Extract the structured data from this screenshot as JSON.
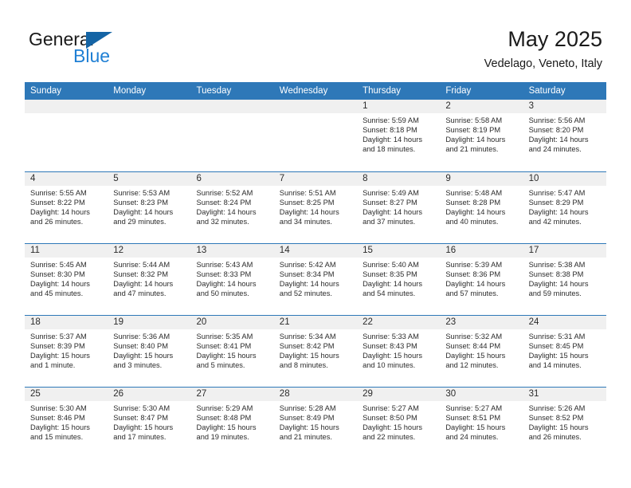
{
  "brand": {
    "name_part1": "General",
    "name_part2": "Blue",
    "flag_icon": "triangle-flag-icon",
    "accent_dark": "#1464a5",
    "accent_blue": "#1f7fd4"
  },
  "header": {
    "title": "May 2025",
    "subtitle": "Vedelago, Veneto, Italy"
  },
  "calendar": {
    "header_bg": "#2e78b8",
    "daynumber_bg": "#f0f0f0",
    "weekdays": [
      "Sunday",
      "Monday",
      "Tuesday",
      "Wednesday",
      "Thursday",
      "Friday",
      "Saturday"
    ],
    "weeks": [
      [
        {
          "day": "",
          "empty": true
        },
        {
          "day": "",
          "empty": true
        },
        {
          "day": "",
          "empty": true
        },
        {
          "day": "",
          "empty": true
        },
        {
          "day": "1",
          "sunrise": "Sunrise: 5:59 AM",
          "sunset": "Sunset: 8:18 PM",
          "daylight": "Daylight: 14 hours and 18 minutes."
        },
        {
          "day": "2",
          "sunrise": "Sunrise: 5:58 AM",
          "sunset": "Sunset: 8:19 PM",
          "daylight": "Daylight: 14 hours and 21 minutes."
        },
        {
          "day": "3",
          "sunrise": "Sunrise: 5:56 AM",
          "sunset": "Sunset: 8:20 PM",
          "daylight": "Daylight: 14 hours and 24 minutes."
        }
      ],
      [
        {
          "day": "4",
          "sunrise": "Sunrise: 5:55 AM",
          "sunset": "Sunset: 8:22 PM",
          "daylight": "Daylight: 14 hours and 26 minutes."
        },
        {
          "day": "5",
          "sunrise": "Sunrise: 5:53 AM",
          "sunset": "Sunset: 8:23 PM",
          "daylight": "Daylight: 14 hours and 29 minutes."
        },
        {
          "day": "6",
          "sunrise": "Sunrise: 5:52 AM",
          "sunset": "Sunset: 8:24 PM",
          "daylight": "Daylight: 14 hours and 32 minutes."
        },
        {
          "day": "7",
          "sunrise": "Sunrise: 5:51 AM",
          "sunset": "Sunset: 8:25 PM",
          "daylight": "Daylight: 14 hours and 34 minutes."
        },
        {
          "day": "8",
          "sunrise": "Sunrise: 5:49 AM",
          "sunset": "Sunset: 8:27 PM",
          "daylight": "Daylight: 14 hours and 37 minutes."
        },
        {
          "day": "9",
          "sunrise": "Sunrise: 5:48 AM",
          "sunset": "Sunset: 8:28 PM",
          "daylight": "Daylight: 14 hours and 40 minutes."
        },
        {
          "day": "10",
          "sunrise": "Sunrise: 5:47 AM",
          "sunset": "Sunset: 8:29 PM",
          "daylight": "Daylight: 14 hours and 42 minutes."
        }
      ],
      [
        {
          "day": "11",
          "sunrise": "Sunrise: 5:45 AM",
          "sunset": "Sunset: 8:30 PM",
          "daylight": "Daylight: 14 hours and 45 minutes."
        },
        {
          "day": "12",
          "sunrise": "Sunrise: 5:44 AM",
          "sunset": "Sunset: 8:32 PM",
          "daylight": "Daylight: 14 hours and 47 minutes."
        },
        {
          "day": "13",
          "sunrise": "Sunrise: 5:43 AM",
          "sunset": "Sunset: 8:33 PM",
          "daylight": "Daylight: 14 hours and 50 minutes."
        },
        {
          "day": "14",
          "sunrise": "Sunrise: 5:42 AM",
          "sunset": "Sunset: 8:34 PM",
          "daylight": "Daylight: 14 hours and 52 minutes."
        },
        {
          "day": "15",
          "sunrise": "Sunrise: 5:40 AM",
          "sunset": "Sunset: 8:35 PM",
          "daylight": "Daylight: 14 hours and 54 minutes."
        },
        {
          "day": "16",
          "sunrise": "Sunrise: 5:39 AM",
          "sunset": "Sunset: 8:36 PM",
          "daylight": "Daylight: 14 hours and 57 minutes."
        },
        {
          "day": "17",
          "sunrise": "Sunrise: 5:38 AM",
          "sunset": "Sunset: 8:38 PM",
          "daylight": "Daylight: 14 hours and 59 minutes."
        }
      ],
      [
        {
          "day": "18",
          "sunrise": "Sunrise: 5:37 AM",
          "sunset": "Sunset: 8:39 PM",
          "daylight": "Daylight: 15 hours and 1 minute."
        },
        {
          "day": "19",
          "sunrise": "Sunrise: 5:36 AM",
          "sunset": "Sunset: 8:40 PM",
          "daylight": "Daylight: 15 hours and 3 minutes."
        },
        {
          "day": "20",
          "sunrise": "Sunrise: 5:35 AM",
          "sunset": "Sunset: 8:41 PM",
          "daylight": "Daylight: 15 hours and 5 minutes."
        },
        {
          "day": "21",
          "sunrise": "Sunrise: 5:34 AM",
          "sunset": "Sunset: 8:42 PM",
          "daylight": "Daylight: 15 hours and 8 minutes."
        },
        {
          "day": "22",
          "sunrise": "Sunrise: 5:33 AM",
          "sunset": "Sunset: 8:43 PM",
          "daylight": "Daylight: 15 hours and 10 minutes."
        },
        {
          "day": "23",
          "sunrise": "Sunrise: 5:32 AM",
          "sunset": "Sunset: 8:44 PM",
          "daylight": "Daylight: 15 hours and 12 minutes."
        },
        {
          "day": "24",
          "sunrise": "Sunrise: 5:31 AM",
          "sunset": "Sunset: 8:45 PM",
          "daylight": "Daylight: 15 hours and 14 minutes."
        }
      ],
      [
        {
          "day": "25",
          "sunrise": "Sunrise: 5:30 AM",
          "sunset": "Sunset: 8:46 PM",
          "daylight": "Daylight: 15 hours and 15 minutes."
        },
        {
          "day": "26",
          "sunrise": "Sunrise: 5:30 AM",
          "sunset": "Sunset: 8:47 PM",
          "daylight": "Daylight: 15 hours and 17 minutes."
        },
        {
          "day": "27",
          "sunrise": "Sunrise: 5:29 AM",
          "sunset": "Sunset: 8:48 PM",
          "daylight": "Daylight: 15 hours and 19 minutes."
        },
        {
          "day": "28",
          "sunrise": "Sunrise: 5:28 AM",
          "sunset": "Sunset: 8:49 PM",
          "daylight": "Daylight: 15 hours and 21 minutes."
        },
        {
          "day": "29",
          "sunrise": "Sunrise: 5:27 AM",
          "sunset": "Sunset: 8:50 PM",
          "daylight": "Daylight: 15 hours and 22 minutes."
        },
        {
          "day": "30",
          "sunrise": "Sunrise: 5:27 AM",
          "sunset": "Sunset: 8:51 PM",
          "daylight": "Daylight: 15 hours and 24 minutes."
        },
        {
          "day": "31",
          "sunrise": "Sunrise: 5:26 AM",
          "sunset": "Sunset: 8:52 PM",
          "daylight": "Daylight: 15 hours and 26 minutes."
        }
      ]
    ]
  }
}
